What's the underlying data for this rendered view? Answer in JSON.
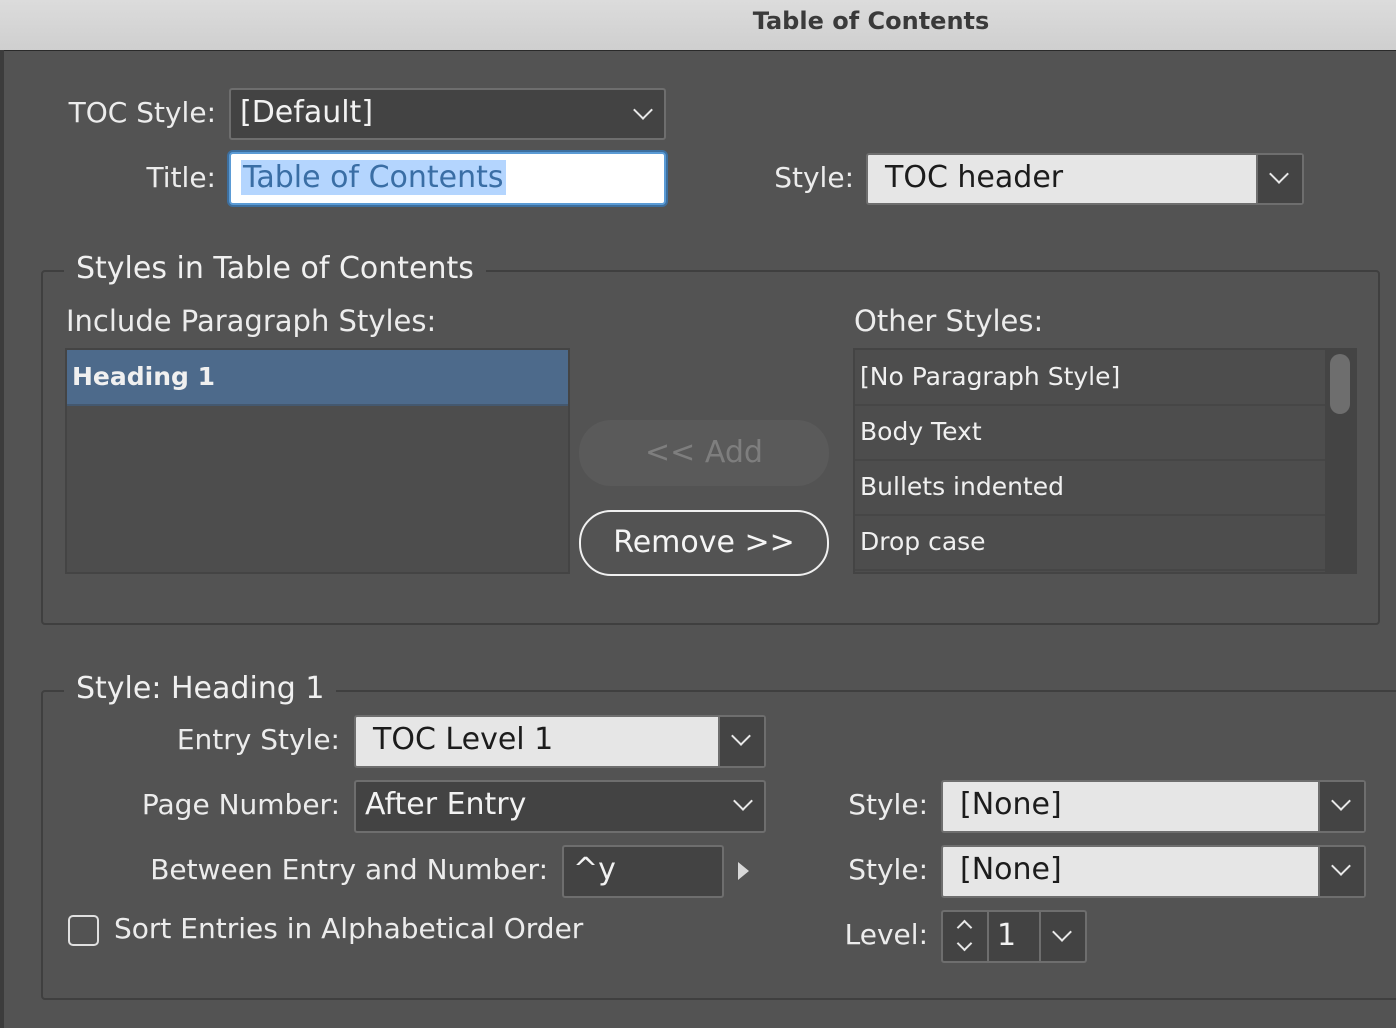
{
  "window": {
    "title": "Table of Contents"
  },
  "toc_style": {
    "label": "TOC Style:",
    "value": "[Default]"
  },
  "title_field": {
    "label": "Title:",
    "value": "Table of Contents"
  },
  "title_style": {
    "label": "Style:",
    "value": "TOC header"
  },
  "styles_group": {
    "legend": "Styles in Table of Contents",
    "include_label": "Include Paragraph Styles:",
    "include_items": [
      "Heading 1"
    ],
    "other_label": "Other Styles:",
    "other_items": [
      "[No Paragraph Style]",
      "Body Text",
      "Bullets indented",
      "Drop case"
    ],
    "add_label": "<< Add",
    "remove_label": "Remove >>"
  },
  "style_group": {
    "legend": "Style: Heading 1",
    "entry_style": {
      "label": "Entry Style:",
      "value": "TOC Level 1"
    },
    "page_number": {
      "label": "Page Number:",
      "value": "After Entry"
    },
    "page_number_style": {
      "label": "Style:",
      "value": "[None]"
    },
    "between": {
      "label": "Between Entry and Number:",
      "value": "^y"
    },
    "between_style": {
      "label": "Style:",
      "value": "[None]"
    },
    "sort": {
      "label": "Sort Entries in Alphabetical Order",
      "checked": false
    },
    "level": {
      "label": "Level:",
      "value": "1"
    }
  },
  "colors": {
    "background": "#535353",
    "selection": "#4d6a8b",
    "focus": "#5b9bd5"
  }
}
